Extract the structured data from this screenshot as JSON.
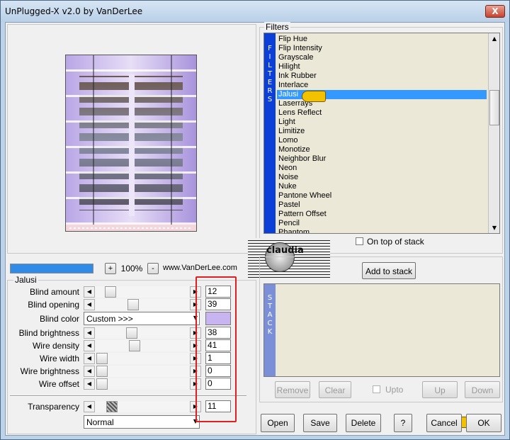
{
  "window": {
    "title": "UnPlugged-X v2.0 by VanDerLee",
    "close": "X"
  },
  "filters": {
    "group_label": "Filters",
    "side_label": [
      "F",
      "I",
      "L",
      "T",
      "E",
      "R",
      "S"
    ],
    "items": [
      "Flip Hue",
      "Flip Intensity",
      "Grayscale",
      "Hilight",
      "Ink Rubber",
      "Interlace",
      "Jalusi",
      "Laserrays",
      "Lens Reflect",
      "Light",
      "Limitize",
      "Lomo",
      "Monotize",
      "Neighbor Blur",
      "Neon",
      "Noise",
      "Nuke",
      "Pantone Wheel",
      "Pastel",
      "Pattern Offset",
      "Pencil",
      "Phantom"
    ],
    "selected": "Jalusi",
    "on_top_label": "On top of stack"
  },
  "stack": {
    "add_label": "Add to stack",
    "side_label": [
      "S",
      "T",
      "A",
      "C",
      "K"
    ],
    "remove_label": "Remove",
    "clear_label": "Clear",
    "upto_label": "Upto",
    "up_label": "Up",
    "down_label": "Down"
  },
  "zoom": {
    "plus": "+",
    "minus": "-",
    "value": "100%",
    "website": "www.VanDerLee.com"
  },
  "watermark": "claudia",
  "params": {
    "group_label": "Jalusi",
    "blind_amount": {
      "label": "Blind amount",
      "value": "12",
      "level": 12
    },
    "blind_opening": {
      "label": "Blind opening",
      "value": "39",
      "level": 39
    },
    "blind_color": {
      "label": "Blind color",
      "select": "Custom >>>",
      "color": "#c8b4f0"
    },
    "blind_brightness": {
      "label": "Blind brightness",
      "value": "38",
      "level": 38
    },
    "wire_density": {
      "label": "Wire density",
      "value": "41",
      "level": 41
    },
    "wire_width": {
      "label": "Wire width",
      "value": "1",
      "level": 1
    },
    "wire_brightness": {
      "label": "Wire brightness",
      "value": "0",
      "level": 0
    },
    "wire_offset": {
      "label": "Wire offset",
      "value": "0",
      "level": 0
    },
    "transparency": {
      "label": "Transparency",
      "value": "11",
      "level": 11
    },
    "blend_mode": "Normal"
  },
  "footer": {
    "open": "Open",
    "save": "Save",
    "delete": "Delete",
    "help": "?",
    "cancel": "Cancel",
    "ok": "OK"
  },
  "colors": {
    "selection": "#3399ff",
    "filters_bar": "#0b3fd8",
    "stack_bar": "#7a8fd8",
    "highlight_box": "#e02020",
    "progress": "#2f8ae8"
  }
}
